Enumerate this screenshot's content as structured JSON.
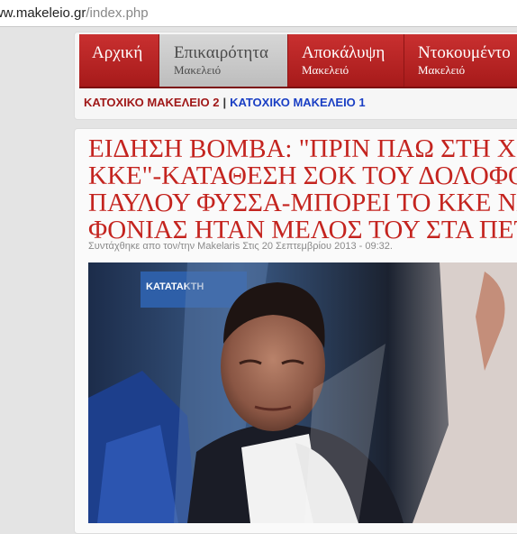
{
  "browser": {
    "url_domain": "www.makeleio.gr",
    "url_path": "/index.php"
  },
  "nav": {
    "items": [
      {
        "label": "Αρχική",
        "sub": ""
      },
      {
        "label": "Επικαιρότητα",
        "sub": "Μακελειό"
      },
      {
        "label": "Αποκάλυψη",
        "sub": "Μακελειό"
      },
      {
        "label": "Ντοκουμέντο",
        "sub": "Μακελειό"
      }
    ],
    "active_index": 1,
    "accent_color": "#b82424"
  },
  "subnav": {
    "link1": "ΚΑΤΟΧΙΚΟ ΜΑΚΕΛΕΙΟ 2",
    "separator": "|",
    "link2": "ΚΑΤΟΧΙΚΟ ΜΑΚΕΛΕΙΟ 1"
  },
  "article": {
    "headline_lines": [
      "ΕΙΔΗΣΗ ΒΟΜΒΑ: \"ΠΡΙΝ ΠΑΩ ΣΤΗ Χ.Α Η",
      "ΚΚΕ\"-ΚΑΤΑΘΕΣΗ ΣΟΚ ΤΟΥ ΔΟΛΟΦΟΝ",
      "ΠΑΥΛΟΥ ΦΥΣΣΑ-ΜΠΟΡΕΙ ΤΟ ΚΚΕ ΝΑ",
      "ΦΟΝΙΑΣ ΗΤΑΝ ΜΕΛΟΣ ΤΟΥ ΣΤΑ ΠΕΤΡ"
    ],
    "meta": "Συντάχθηκε απο τον/την Makelaris Στις 20 Σεπτεμβρίου 2013 - 09:32.",
    "photo_sign_text": "ΚΑΤΑΤΑΚΤΗ",
    "headline_color": "#c4241f"
  }
}
